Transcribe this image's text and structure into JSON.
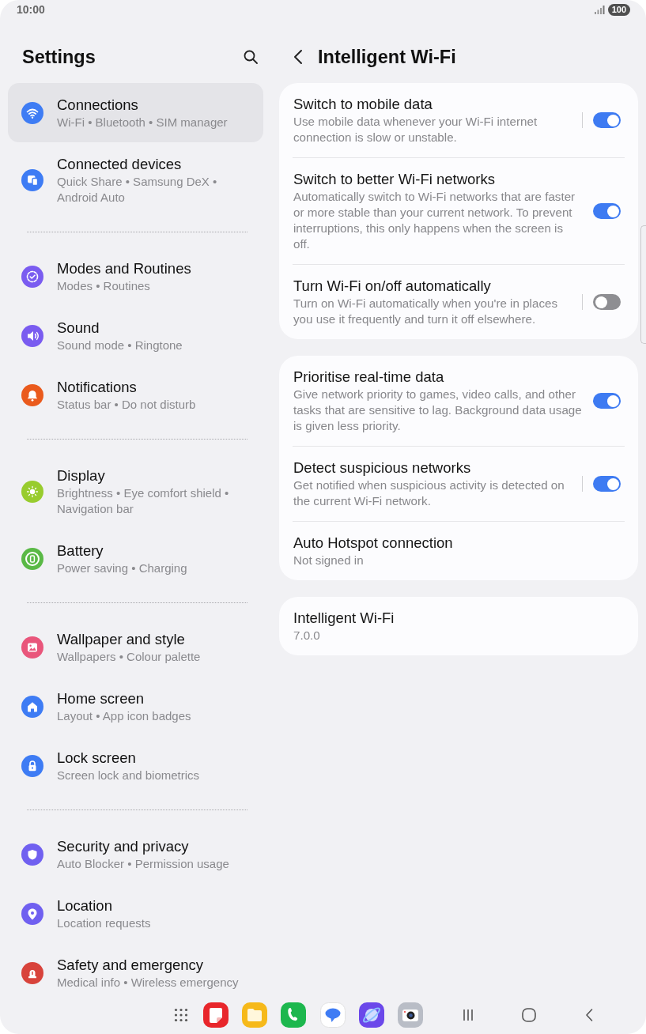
{
  "status_bar": {
    "time": "10:00",
    "battery": "100"
  },
  "sidebar": {
    "title": "Settings",
    "groups": [
      {
        "items": [
          {
            "title": "Connections",
            "subtitle": "Wi-Fi • Bluetooth • SIM manager",
            "color": "#3e7cf4",
            "selected": true
          },
          {
            "title": "Connected devices",
            "subtitle": "Quick Share • Samsung DeX • Android Auto",
            "color": "#3e7cf4",
            "selected": false
          }
        ]
      },
      {
        "items": [
          {
            "title": "Modes and Routines",
            "subtitle": "Modes • Routines",
            "color": "#7a5cf0",
            "selected": false
          },
          {
            "title": "Sound",
            "subtitle": "Sound mode • Ringtone",
            "color": "#7a5cf0",
            "selected": false
          },
          {
            "title": "Notifications",
            "subtitle": "Status bar • Do not disturb",
            "color": "#ea5a1c",
            "selected": false
          }
        ]
      },
      {
        "items": [
          {
            "title": "Display",
            "subtitle": "Brightness • Eye comfort shield • Navigation bar",
            "color": "#98cc2e",
            "selected": false
          },
          {
            "title": "Battery",
            "subtitle": "Power saving • Charging",
            "color": "#5ab946",
            "selected": false
          }
        ]
      },
      {
        "items": [
          {
            "title": "Wallpaper and style",
            "subtitle": "Wallpapers • Colour palette",
            "color": "#e9567b",
            "selected": false
          },
          {
            "title": "Home screen",
            "subtitle": "Layout • App icon badges",
            "color": "#3e7cf4",
            "selected": false
          },
          {
            "title": "Lock screen",
            "subtitle": "Screen lock and biometrics",
            "color": "#3e7cf4",
            "selected": false
          }
        ]
      },
      {
        "items": [
          {
            "title": "Security and privacy",
            "subtitle": "Auto Blocker • Permission usage",
            "color": "#7060f0",
            "selected": false
          },
          {
            "title": "Location",
            "subtitle": "Location requests",
            "color": "#7060f0",
            "selected": false
          },
          {
            "title": "Safety and emergency",
            "subtitle": "Medical info • Wireless emergency",
            "color": "#d8433b",
            "selected": false
          }
        ]
      }
    ]
  },
  "detail": {
    "title": "Intelligent Wi-Fi",
    "cards": [
      {
        "rows": [
          {
            "kind": "toggle",
            "title": "Switch to mobile data",
            "description": "Use mobile data whenever your Wi-Fi internet connection is slow or unstable.",
            "separator": true,
            "on": true
          },
          {
            "kind": "toggle",
            "title": "Switch to better Wi-Fi networks",
            "description": "Automatically switch to Wi-Fi networks that are faster or more stable than your current network. To prevent interruptions, this only happens when the screen is off.",
            "separator": false,
            "on": true
          },
          {
            "kind": "toggle",
            "title": "Turn Wi-Fi on/off automatically",
            "description": "Turn on Wi-Fi automatically when you're in places you use it frequently and turn it off elsewhere.",
            "separator": true,
            "on": false
          }
        ]
      },
      {
        "rows": [
          {
            "kind": "toggle",
            "title": "Prioritise real-time data",
            "description": "Give network priority to games, video calls, and other tasks that are sensitive to lag. Background data usage is given less priority.",
            "separator": false,
            "on": true
          },
          {
            "kind": "toggle",
            "title": "Detect suspicious networks",
            "description": "Get notified when suspicious activity is detected on the current Wi-Fi network.",
            "separator": true,
            "on": true
          },
          {
            "kind": "info",
            "title": "Auto Hotspot connection",
            "description": "Not signed in"
          }
        ]
      },
      {
        "rows": [
          {
            "kind": "info",
            "title": "Intelligent Wi-Fi",
            "description": "7.0.0"
          }
        ]
      }
    ]
  }
}
